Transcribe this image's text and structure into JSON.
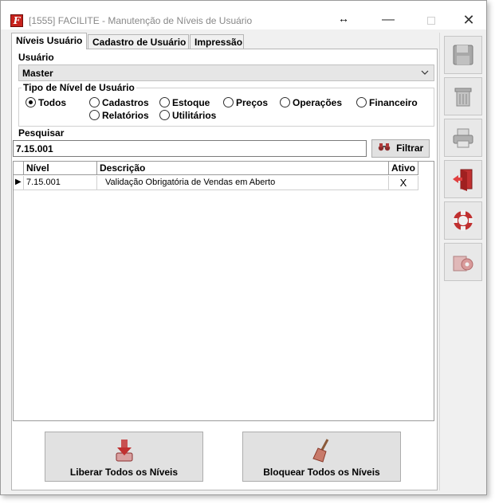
{
  "window": {
    "title": "[1555] FACILITE - Manutenção de Níveis de Usuário",
    "logo_letter": "F",
    "resize_glyph": "↔",
    "minimize_glyph": "—",
    "close_glyph": "✕"
  },
  "tabs": [
    {
      "label": "Níveis Usuário",
      "active": true
    },
    {
      "label": "Cadastro de Usuário",
      "active": false
    },
    {
      "label": "Impressão",
      "active": false
    }
  ],
  "usuario": {
    "label": "Usuário",
    "value": "Master"
  },
  "tipo_nivel": {
    "label": "Tipo de Nível de Usuário",
    "options": [
      {
        "label": "Todos",
        "checked": true
      },
      {
        "label": "Cadastros",
        "checked": false
      },
      {
        "label": "Estoque",
        "checked": false
      },
      {
        "label": "Preços",
        "checked": false
      },
      {
        "label": "Operações",
        "checked": false
      },
      {
        "label": "Financeiro",
        "checked": false
      },
      {
        "label": "Relatórios",
        "checked": false
      },
      {
        "label": "Utilitários",
        "checked": false
      }
    ]
  },
  "pesquisar": {
    "label": "Pesquisar",
    "value": "7.15.001",
    "filter_label": "Filtrar"
  },
  "grid": {
    "columns": [
      "Nível",
      "Descrição",
      "Ativo"
    ],
    "rows": [
      {
        "indicator": "▶",
        "nivel": "7.15.001",
        "descricao": "Validação Obrigatória de Vendas em Aberto",
        "ativo": "X"
      }
    ]
  },
  "actions": {
    "liberar_label": "Liberar Todos os Níveis",
    "bloquear_label": "Bloquear Todos os Níveis"
  },
  "toolbar": {
    "icons": [
      "save-icon",
      "trash-icon",
      "printer-icon",
      "exit-door-icon",
      "help-lifebuoy-icon",
      "settings-gear-icon"
    ]
  },
  "colors": {
    "accent_red": "#c7221c",
    "button_face": "#e1e1e1"
  }
}
